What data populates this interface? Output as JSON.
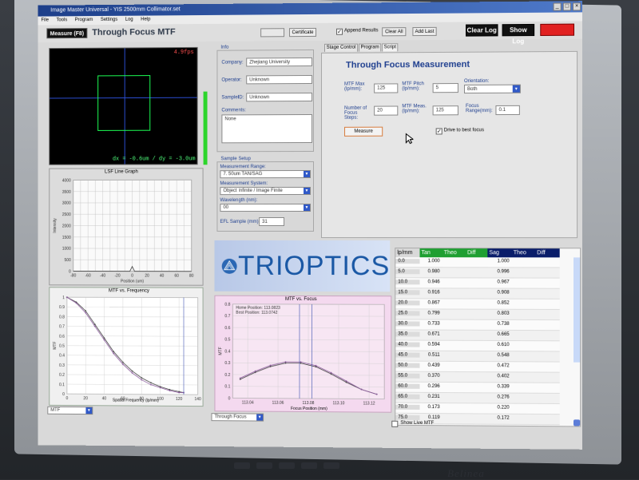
{
  "window": {
    "title": "Image Master Universal - YIS 2500mm Collimator.set"
  },
  "menu": [
    "File",
    "Tools",
    "Program",
    "Settings",
    "Log",
    "Help"
  ],
  "toolbar": {
    "measure_button": "Measure (F8)",
    "heading": "Through Focus MTF",
    "certificate": "Certificate",
    "append_results": "Append Results",
    "clear_all": "Clear All",
    "add_last": "Add Last",
    "clear_log": "Clear Log",
    "show_log": "Show Log"
  },
  "camera": {
    "fps": "4.9fps",
    "coords": "dx = -0.6um / dy = -3.0um"
  },
  "info": {
    "section": "Info",
    "company_label": "Company:",
    "company_value": "Zhejiang University",
    "operator_label": "Operator:",
    "operator_value": "Unknown",
    "sample_label": "SampleID:",
    "sample_value": "Unknown",
    "comments_label": "Comments:",
    "comments_value": "None"
  },
  "sample_setup": {
    "section": "Sample Setup",
    "range_label": "Measurement Range:",
    "range_value": "7. 50um TAN/SAG",
    "system_label": "Measurement System:",
    "system_value": "Object Infinite / Image Finite",
    "wavelength_label": "Wavelength (nm):",
    "wavelength_value": "00",
    "efl_label": "EFL Sample (mm):",
    "efl_value": "31"
  },
  "tabs": [
    "Stage Control",
    "Program",
    "Script"
  ],
  "through_focus": {
    "title": "Through Focus Measurement",
    "mtf_max_label": "MTF Max (lp/mm):",
    "mtf_max": "125",
    "mtf_pitch_label": "MTF Pitch (lp/mm):",
    "mtf_pitch": "5",
    "orientation_label": "Orientation:",
    "orientation": "Both",
    "steps_label": "Number of Focus Steps:",
    "steps": "20",
    "mtf_meas_label": "MTF Meas. (lp/mm):",
    "mtf_meas": "125",
    "focus_range_label": "Focus Range(mm):",
    "focus_range": "0.1",
    "measure_button": "Measure",
    "drive_to_best": "Drive to best focus"
  },
  "lsf_graph": {
    "title": "LSF Line Graph",
    "xlabel": "Position (um)",
    "ylabel": "Intensity",
    "ylim": [
      0,
      4000
    ],
    "xlim": [
      -80,
      80
    ]
  },
  "mtf_freq_graph": {
    "title": "MTF vs. Frequency",
    "xlabel": "Spatial Frequency (lp/mm)",
    "ylabel": "MTF",
    "select": "MTF"
  },
  "mtf_focus_graph": {
    "title": "MTF vs. Focus",
    "xlabel": "Focus Position (mm)",
    "ylabel": "MTF",
    "home_position": "Home Position: 113.0823",
    "best_position": "Best Position: 113.0742",
    "select": "Through Focus"
  },
  "chart_data": [
    {
      "type": "line",
      "title": "MTF vs. Frequency",
      "xlabel": "Spatial Frequency (lp/mm)",
      "ylabel": "MTF",
      "xlim": [
        0,
        140
      ],
      "ylim": [
        0,
        1
      ],
      "x": [
        0,
        10,
        20,
        30,
        40,
        50,
        60,
        70,
        80,
        90,
        100,
        110,
        120,
        125
      ],
      "series": [
        {
          "name": "Tan",
          "values": [
            1.0,
            0.95,
            0.86,
            0.72,
            0.58,
            0.44,
            0.33,
            0.24,
            0.17,
            0.12,
            0.08,
            0.05,
            0.03,
            0.02
          ]
        },
        {
          "name": "Sag",
          "values": [
            1.0,
            0.94,
            0.84,
            0.7,
            0.56,
            0.42,
            0.31,
            0.22,
            0.15,
            0.1,
            0.07,
            0.04,
            0.02,
            0.02
          ]
        }
      ]
    },
    {
      "type": "line",
      "title": "MTF vs. Focus",
      "xlabel": "Focus Position (mm)",
      "ylabel": "MTF",
      "xlim": [
        113.03,
        113.13
      ],
      "ylim": [
        0,
        0.8
      ],
      "x": [
        113.035,
        113.045,
        113.055,
        113.065,
        113.075,
        113.085,
        113.095,
        113.105,
        113.115,
        113.125
      ],
      "series": [
        {
          "name": "Tan",
          "values": [
            0.16,
            0.22,
            0.27,
            0.3,
            0.3,
            0.27,
            0.21,
            0.14,
            0.08,
            0.04
          ]
        },
        {
          "name": "Sag",
          "values": [
            0.17,
            0.23,
            0.28,
            0.31,
            0.31,
            0.28,
            0.22,
            0.15,
            0.08,
            0.04
          ]
        }
      ]
    }
  ],
  "results_table": {
    "headers": [
      "lp/mm",
      "Tan",
      "Theo",
      "Diff",
      "Sag",
      "Theo",
      "Diff"
    ],
    "rows": [
      [
        "0.0",
        "1.000",
        "1.000"
      ],
      [
        "5.0",
        "0.980",
        "0.996"
      ],
      [
        "10.0",
        "0.946",
        "0.967"
      ],
      [
        "15.0",
        "0.916",
        "0.908"
      ],
      [
        "20.0",
        "0.867",
        "0.852"
      ],
      [
        "25.0",
        "0.799",
        "0.803"
      ],
      [
        "30.0",
        "0.733",
        "0.738"
      ],
      [
        "35.0",
        "0.671",
        "0.665"
      ],
      [
        "40.0",
        "0.594",
        "0.610"
      ],
      [
        "45.0",
        "0.511",
        "0.548"
      ],
      [
        "50.0",
        "0.439",
        "0.472"
      ],
      [
        "55.0",
        "0.370",
        "0.402"
      ],
      [
        "60.0",
        "0.296",
        "0.339"
      ],
      [
        "65.0",
        "0.231",
        "0.276"
      ],
      [
        "70.0",
        "0.173",
        "0.220"
      ],
      [
        "75.0",
        "0.119",
        "0.172"
      ]
    ],
    "show_live": "Show Live MTF"
  },
  "logo": {
    "brand": "TRIOPTICS"
  },
  "monitor": {
    "brand": "Belinea"
  },
  "colors": {
    "titlebar": "#1d3f8a",
    "label": "#1f3f8f",
    "accent_green": "#2cd52b",
    "table_header_green": "#1f9f32",
    "table_header_blue": "#0a1d6a",
    "focus_bg": "#f4d9ef"
  }
}
